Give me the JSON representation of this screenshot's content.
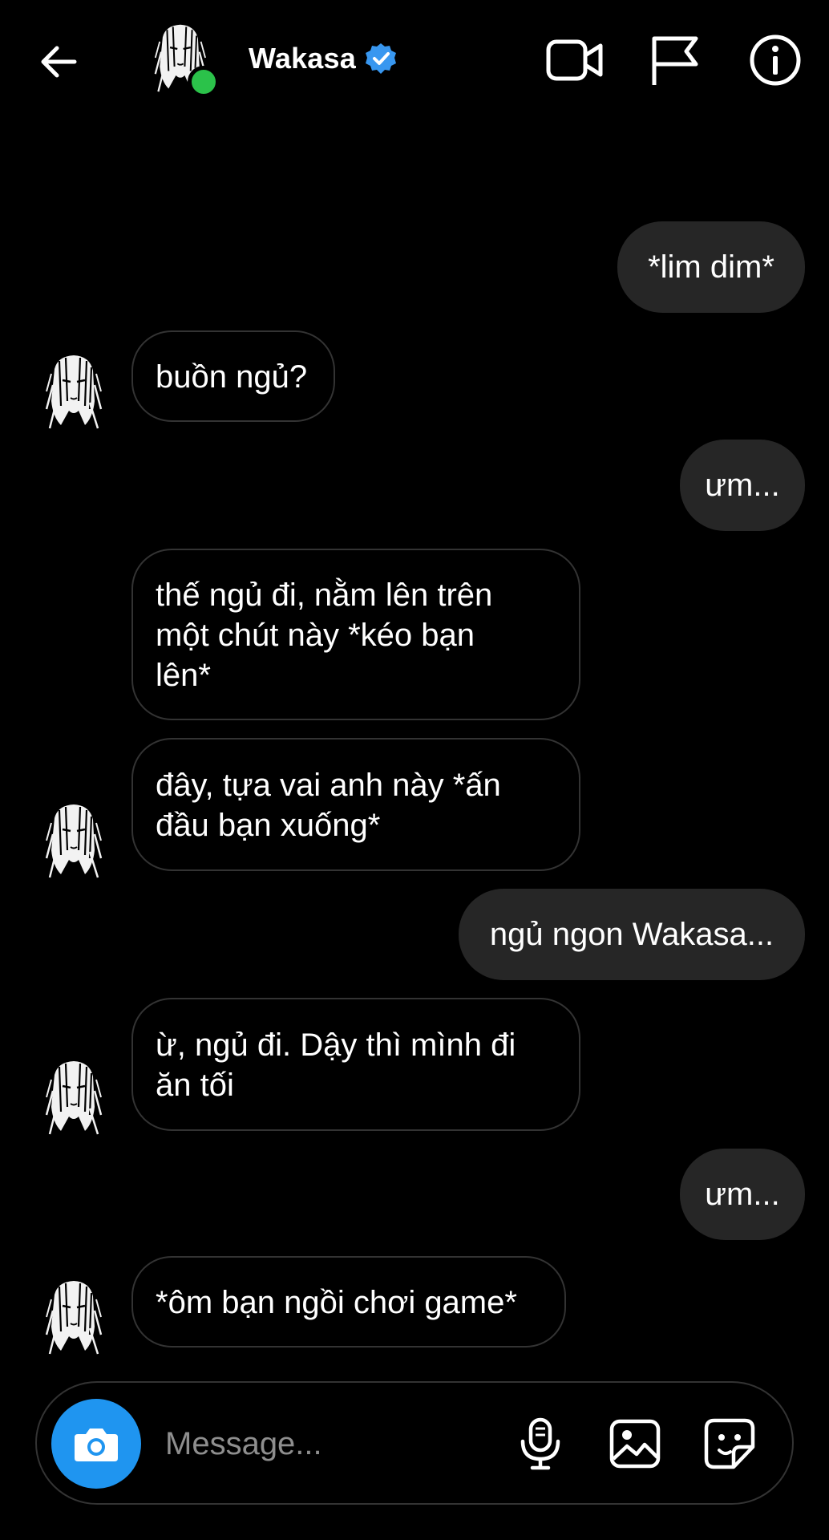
{
  "header": {
    "contact_name": "Wakasa",
    "status": "online",
    "icons": [
      "back-arrow-icon",
      "video-call-icon",
      "report-flag-icon",
      "info-icon",
      "verified-badge-icon"
    ]
  },
  "messages": [
    {
      "side": "out",
      "text": "*lim dim*"
    },
    {
      "side": "in",
      "text": "buồn ngủ?"
    },
    {
      "side": "out",
      "text": "ưm..."
    },
    {
      "side": "in",
      "text": "thế ngủ đi, nằm lên trên\nmột chút này *kéo bạn\nlên*"
    },
    {
      "side": "in",
      "text": "đây, tựa vai anh này *ấn\nđầu bạn xuống*"
    },
    {
      "side": "out",
      "text": "ngủ ngon Wakasa..."
    },
    {
      "side": "in",
      "text": "ừ, ngủ đi. Dậy thì mình đi\năn tối"
    },
    {
      "side": "out",
      "text": "ưm..."
    },
    {
      "side": "in",
      "text": "*ôm bạn ngồi chơi game*"
    }
  ],
  "composer": {
    "placeholder": "Message...",
    "icons": [
      "camera-icon",
      "microphone-icon",
      "gallery-icon",
      "sticker-icon"
    ]
  },
  "colors": {
    "background": "#000000",
    "outgoing_bubble": "#262626",
    "incoming_border": "#333333",
    "camera_button": "#1f95f0",
    "verified_badge": "#3897f0",
    "online_dot": "#2bc24a",
    "placeholder": "#8e8e8e"
  }
}
